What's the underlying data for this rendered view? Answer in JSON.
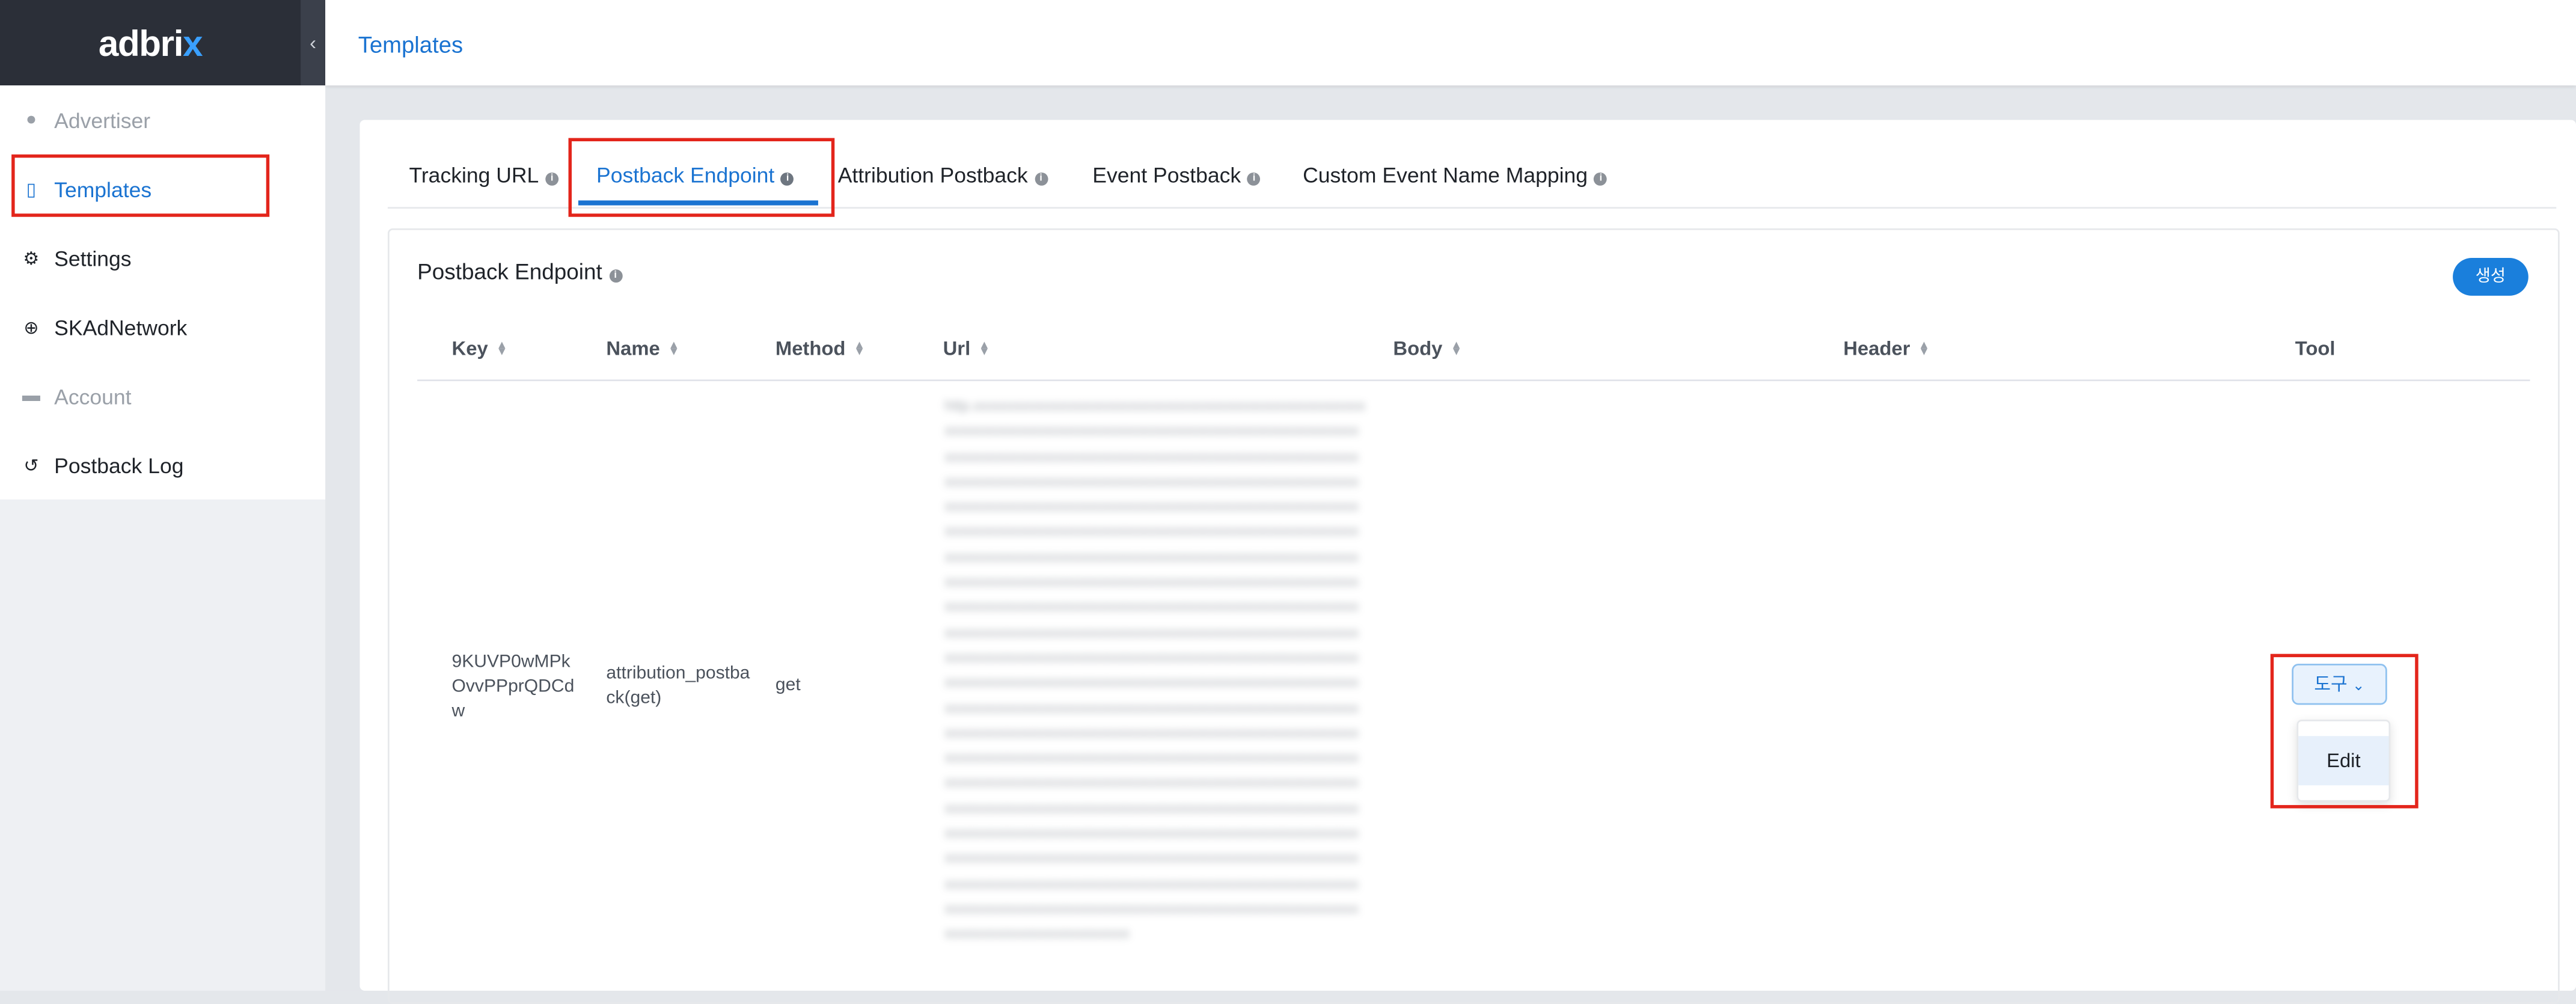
{
  "logo": {
    "main": "adbri",
    "accent": "x"
  },
  "sidebar": {
    "collapse_icon": "‹",
    "items": [
      {
        "label": "Advertiser",
        "icon": "user-icon",
        "glyph": "👤",
        "state": "disabled"
      },
      {
        "label": "Templates",
        "icon": "clipboard-icon",
        "glyph": "▯",
        "state": "active"
      },
      {
        "label": "Settings",
        "icon": "gear-icon",
        "glyph": "⚙",
        "state": "normal"
      },
      {
        "label": "SKAdNetwork",
        "icon": "network-icon",
        "glyph": "⊕",
        "state": "normal"
      },
      {
        "label": "Account",
        "icon": "briefcase-icon",
        "glyph": "▬",
        "state": "disabled"
      },
      {
        "label": "Postback Log",
        "icon": "history-icon",
        "glyph": "↺",
        "state": "normal"
      }
    ]
  },
  "header": {
    "title": "Templates"
  },
  "tabs": [
    {
      "label": "Tracking URL",
      "active": false
    },
    {
      "label": "Postback Endpoint",
      "active": true
    },
    {
      "label": "Attribution Postback",
      "active": false
    },
    {
      "label": "Event Postback",
      "active": false
    },
    {
      "label": "Custom Event Name Mapping",
      "active": false
    }
  ],
  "section": {
    "title": "Postback Endpoint",
    "create_label": "생성"
  },
  "table": {
    "columns": [
      "Key",
      "Name",
      "Method",
      "Url",
      "Body",
      "Header",
      "Tool"
    ],
    "rows": [
      {
        "key": "9KUVP0wMPkOvvPPprQDCdw",
        "name": "attribution_postback(get)",
        "method": "get",
        "url": "",
        "body": "",
        "header": ""
      }
    ]
  },
  "tool": {
    "label": "도구",
    "chevron": "⌄",
    "menu": [
      "Edit"
    ]
  },
  "colors": {
    "accent": "#1a73d1",
    "highlight": "#e3251b",
    "logo_bg": "#2b2f38"
  }
}
